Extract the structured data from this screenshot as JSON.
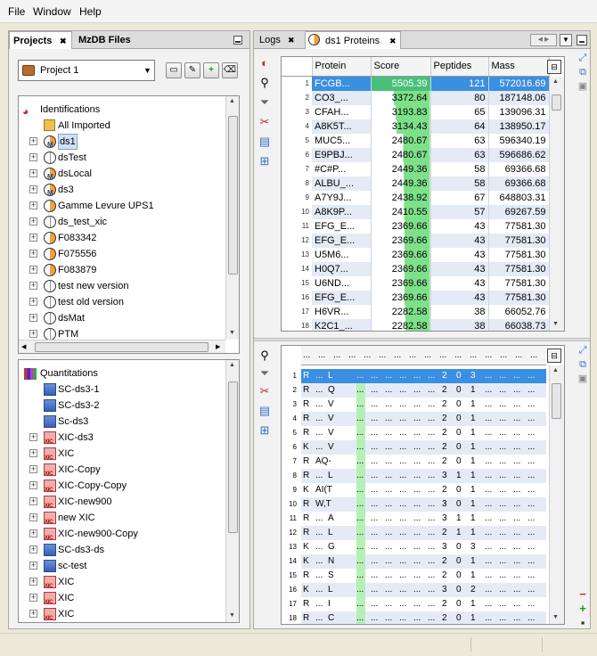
{
  "menu": [
    "File",
    "Window",
    "Help"
  ],
  "left": {
    "tabs": {
      "projects": "Projects",
      "mzdb": "MzDB Files"
    },
    "project_select": "Project 1",
    "identifications": {
      "root": "Identifications",
      "items": [
        "All Imported",
        "ds1",
        "dsTest",
        "dsLocal",
        "ds3",
        "Gamme Levure UPS1",
        "ds_test_xic",
        "F083342",
        "F075556",
        "F083879",
        "test new version",
        "test old version",
        "dsMat",
        "PTM"
      ]
    },
    "quantitations": {
      "root": "Quantitations",
      "items": [
        "SC-ds3-1",
        "SC-ds3-2",
        "Sc-ds3",
        "XIC-ds3",
        "XIC",
        "XIC-Copy",
        "XIC-Copy-Copy",
        "XIC-new900",
        "new  XIC",
        "XIC-new900-Copy",
        "SC-ds3-ds",
        "sc-test",
        "XIC",
        "XIC",
        "XIC"
      ]
    }
  },
  "right": {
    "tabs": {
      "logs": "Logs",
      "proteins": "ds1 Proteins"
    },
    "proteins": {
      "columns": [
        "Protein",
        "Score",
        "Peptides",
        "Mass"
      ],
      "rows": [
        [
          "1",
          "FCGB...",
          "5505.39",
          "121",
          "572016.69"
        ],
        [
          "2",
          "CO3_...",
          "3372.64",
          "80",
          "187148.06"
        ],
        [
          "3",
          "CFAH...",
          "3193.83",
          "65",
          "139096.31"
        ],
        [
          "4",
          "A8K5T...",
          "3134.43",
          "64",
          "138950.17"
        ],
        [
          "5",
          "MUC5...",
          "2480.67",
          "63",
          "596340.19"
        ],
        [
          "6",
          "E9PBJ...",
          "2480.67",
          "63",
          "596686.62"
        ],
        [
          "7",
          "#C#P...",
          "2449.36",
          "58",
          "69366.68"
        ],
        [
          "8",
          "ALBU_...",
          "2449.36",
          "58",
          "69366.68"
        ],
        [
          "9",
          "A7Y9J...",
          "2438.92",
          "67",
          "648803.31"
        ],
        [
          "10",
          "A8K9P...",
          "2410.55",
          "57",
          "69267.59"
        ],
        [
          "11",
          "EFG_E...",
          "2369.66",
          "43",
          "77581.30"
        ],
        [
          "12",
          "EFG_E...",
          "2369.66",
          "43",
          "77581.30"
        ],
        [
          "13",
          "U5M6...",
          "2369.66",
          "43",
          "77581.30"
        ],
        [
          "14",
          "H0Q7...",
          "2369.66",
          "43",
          "77581.30"
        ],
        [
          "15",
          "U6ND...",
          "2369.66",
          "43",
          "77581.30"
        ],
        [
          "16",
          "EFG_E...",
          "2369.66",
          "43",
          "77581.30"
        ],
        [
          "17",
          "H6VR...",
          "2282.58",
          "38",
          "66052.76"
        ],
        [
          "18",
          "K2C1_...",
          "2282.58",
          "38",
          "66038.73"
        ]
      ]
    },
    "peptides": {
      "header_dots": [
        "...",
        "...",
        "...",
        "...",
        "...",
        "...",
        "...",
        "...",
        "...",
        "...",
        "...",
        "...",
        "...",
        "...",
        "...",
        "..."
      ],
      "rows": [
        [
          "1",
          "R",
          "...",
          "L",
          "2",
          "0",
          "3"
        ],
        [
          "2",
          "R",
          "...",
          "Q",
          "2",
          "0",
          "1"
        ],
        [
          "3",
          "R",
          "...",
          "V",
          "2",
          "0",
          "1"
        ],
        [
          "4",
          "R",
          "...",
          "V",
          "2",
          "0",
          "1"
        ],
        [
          "5",
          "R",
          "...",
          "V",
          "2",
          "0",
          "1"
        ],
        [
          "6",
          "K",
          "...",
          "V",
          "2",
          "0",
          "1"
        ],
        [
          "7",
          "R",
          "AQ-",
          "",
          "2",
          "0",
          "1"
        ],
        [
          "8",
          "R",
          "...",
          "L",
          "3",
          "1",
          "1"
        ],
        [
          "9",
          "K",
          "AI(T",
          "",
          "2",
          "0",
          "1"
        ],
        [
          "10",
          "R",
          "W,T",
          "",
          "3",
          "0",
          "1"
        ],
        [
          "11",
          "R",
          "...",
          "A",
          "3",
          "1",
          "1"
        ],
        [
          "12",
          "R",
          "...",
          "L",
          "2",
          "1",
          "1"
        ],
        [
          "13",
          "K",
          "...",
          "G",
          "3",
          "0",
          "3"
        ],
        [
          "14",
          "K",
          "...",
          "N",
          "2",
          "0",
          "1"
        ],
        [
          "15",
          "R",
          "...",
          "S",
          "2",
          "0",
          "1"
        ],
        [
          "16",
          "K",
          "...",
          "L",
          "3",
          "0",
          "2"
        ],
        [
          "17",
          "R",
          "...",
          "I",
          "2",
          "0",
          "1"
        ],
        [
          "18",
          "R",
          "...",
          "C",
          "2",
          "0",
          "1"
        ]
      ],
      "dots": "..."
    }
  },
  "colors": {
    "selection": "#3b8fe0",
    "score_bar": "#7fe08a",
    "alt_row": "#e4ebf6"
  },
  "score_max": 5505.39
}
